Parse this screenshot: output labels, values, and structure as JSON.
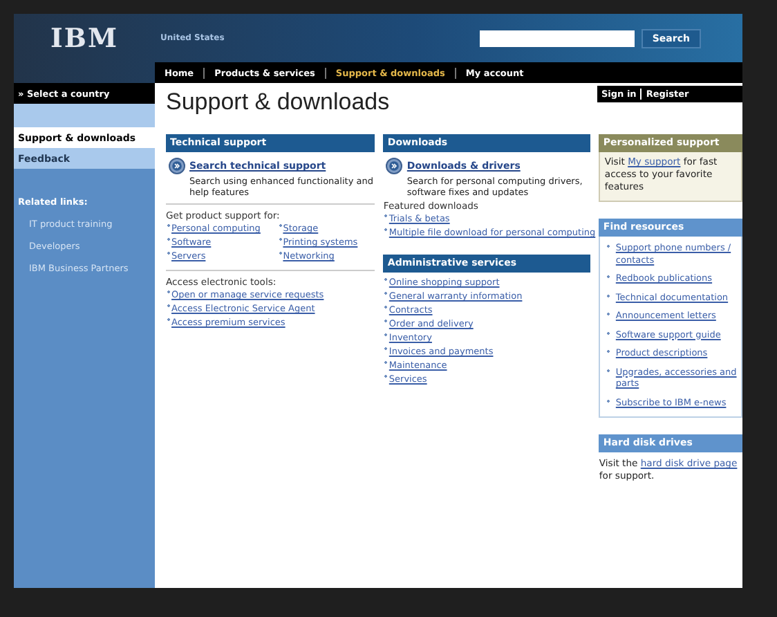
{
  "header": {
    "logo": "IBM",
    "country": "United States",
    "search_button": "Search"
  },
  "nav": [
    {
      "label": "Home",
      "selected": false
    },
    {
      "label": "Products & services",
      "selected": false
    },
    {
      "label": "Support & downloads",
      "selected": true
    },
    {
      "label": "My account",
      "selected": false
    }
  ],
  "sidebar": {
    "country_link": "» Select a country",
    "items": [
      {
        "label": "Support & downloads",
        "selected": true
      },
      {
        "label": "Feedback",
        "selected": false
      }
    ],
    "related_heading": "Related links:",
    "related": [
      "IT product training",
      "Developers",
      "IBM Business Partners"
    ]
  },
  "account": {
    "sign_in": "Sign in",
    "register": "Register"
  },
  "page_title": "Support & downloads",
  "technical_support": {
    "heading": "Technical support",
    "feature_link": "Search technical support",
    "feature_text": "Search using enhanced functionality and help features",
    "products_heading": "Get product support for:",
    "products_column_1": [
      "Personal computing",
      "Software",
      "Servers"
    ],
    "products_column_2": [
      "Storage",
      "Printing systems",
      "Networking"
    ],
    "tools_heading": "Access electronic tools:",
    "tools": [
      "Open or manage service requests",
      "Access Electronic Service Agent",
      "Access premium services"
    ]
  },
  "downloads": {
    "heading": "Downloads",
    "feature_link": "Downloads & drivers",
    "feature_text": "Search for personal computing drivers, software fixes and updates",
    "featured_heading": "Featured downloads",
    "featured": [
      "Trials & betas",
      "Multiple file download for personal computing"
    ]
  },
  "administrative_services": {
    "heading": "Administrative services",
    "links": [
      "Online shopping support",
      "General warranty information",
      "Contracts",
      "Order and delivery",
      "Inventory",
      "Invoices and payments",
      "Maintenance",
      "Services"
    ]
  },
  "personalized_support": {
    "heading": "Personalized support",
    "text_before": "Visit ",
    "link": "My support",
    "text_after": " for fast access to your favorite features"
  },
  "find_resources": {
    "heading": "Find resources",
    "links": [
      "Support phone numbers / contacts",
      "Redbook publications",
      "Technical documentation",
      "Announcement letters",
      "Software support guide",
      "Product descriptions",
      "Upgrades, accessories and parts",
      "Subscribe to IBM e-news"
    ]
  },
  "hard_disk_drives": {
    "heading": "Hard disk drives",
    "text_before": "Visit the ",
    "link": "hard disk drive page",
    "text_after": " for support."
  }
}
